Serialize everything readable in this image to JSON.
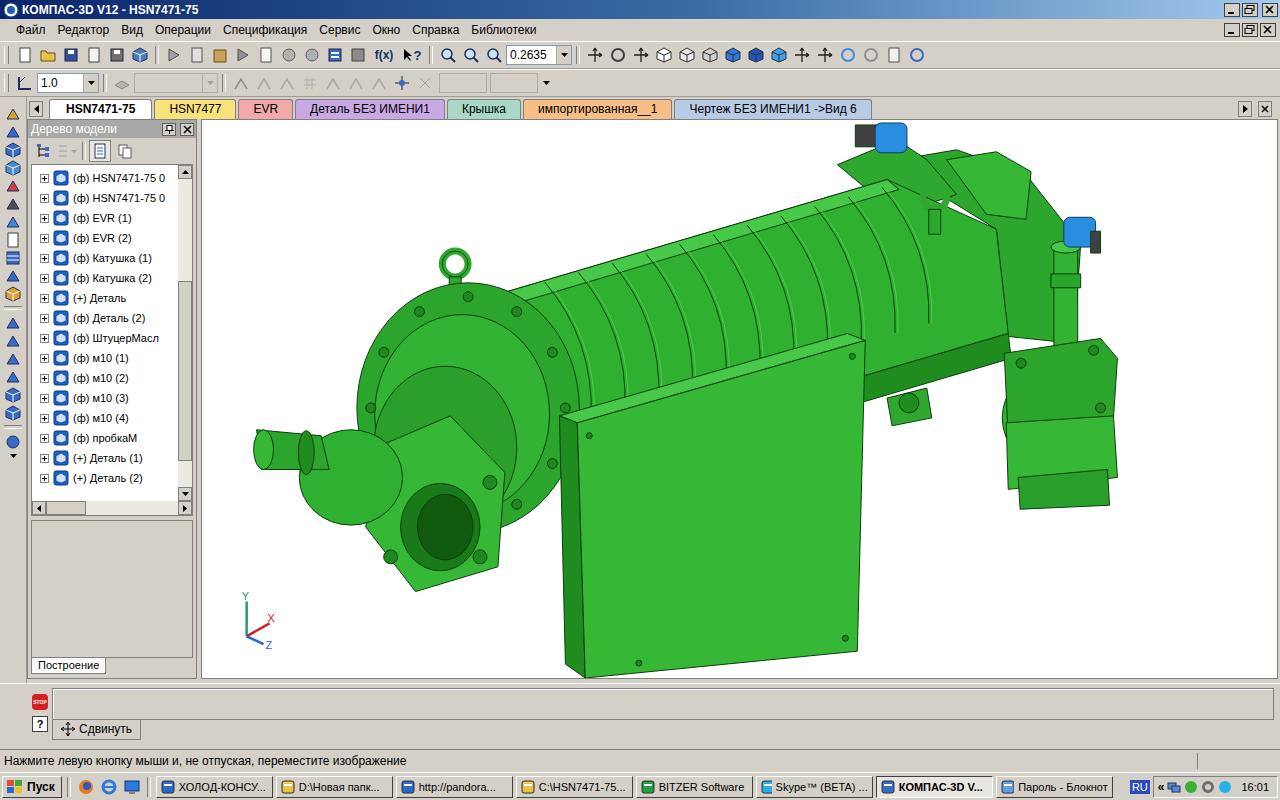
{
  "window": {
    "title": "КОМПАС-3D V12 - HSN7471-75"
  },
  "menu": [
    "Файл",
    "Редактор",
    "Вид",
    "Операции",
    "Спецификация",
    "Сервис",
    "Окно",
    "Справка",
    "Библиотеки"
  ],
  "toolbar": {
    "fx": "f(x)",
    "help": "?",
    "zoom": "0.2635",
    "line_scale": "1.0"
  },
  "tabs": [
    {
      "label": "HSN7471-75",
      "selected": true,
      "color": "#ffffff"
    },
    {
      "label": "HSN7477",
      "selected": false,
      "color": "#f7e27c"
    },
    {
      "label": "EVR",
      "selected": false,
      "color": "#f2a9a9"
    },
    {
      "label": "Деталь БЕЗ ИМЕНИ1",
      "selected": false,
      "color": "#c9a9e3"
    },
    {
      "label": "Крышка",
      "selected": false,
      "color": "#a9d9c6"
    },
    {
      "label": "импортированная__1",
      "selected": false,
      "color": "#f7bf86"
    },
    {
      "label": "Чертеж БЕЗ ИМЕНИ1 ->Вид 6",
      "selected": false,
      "color": "#b8cbe6"
    }
  ],
  "tree": {
    "title": "Дерево модели",
    "tab": "Построение",
    "items": [
      {
        "label": "(ф) HSN7471-75 0",
        "expanded": false
      },
      {
        "label": "(ф) HSN7471-75 0",
        "expanded": false
      },
      {
        "label": "(ф) EVR (1)",
        "expanded": false
      },
      {
        "label": "(ф) EVR (2)",
        "expanded": false
      },
      {
        "label": "(ф) Катушка (1)",
        "expanded": false
      },
      {
        "label": "(ф) Катушка (2)",
        "expanded": false
      },
      {
        "label": "(+) Деталь",
        "expanded": false
      },
      {
        "label": "(ф) Деталь (2)",
        "expanded": false
      },
      {
        "label": "(ф) ШтуцерМасл",
        "expanded": false
      },
      {
        "label": "(ф) м10 (1)",
        "expanded": false
      },
      {
        "label": "(ф) м10 (2)",
        "expanded": false
      },
      {
        "label": "(ф) м10 (3)",
        "expanded": false
      },
      {
        "label": "(ф) м10 (4)",
        "expanded": false
      },
      {
        "label": "(ф) пробкаМ",
        "expanded": false
      },
      {
        "label": "(+) Деталь (1)",
        "expanded": false
      },
      {
        "label": "(+) Деталь (2)",
        "expanded": false
      }
    ]
  },
  "viewport": {
    "axes": [
      {
        "label": "Y",
        "color": "#2a9a6a"
      },
      {
        "label": "X",
        "color": "#d02020"
      },
      {
        "label": "Z",
        "color": "#2466d6"
      }
    ]
  },
  "command": {
    "stop": "STOP",
    "help": "?",
    "tab": "Сдвинуть"
  },
  "status": "Нажмите левую кнопку мыши и, не отпуская, переместите изображение",
  "taskbar": {
    "start": "Пуск",
    "tasks": [
      {
        "label": "ХОЛОД-КОНСУ...",
        "selected": false
      },
      {
        "label": "D:\\Новая папк...",
        "selected": false
      },
      {
        "label": "http://pandora...",
        "selected": false
      },
      {
        "label": "C:\\HSN7471-75...",
        "selected": false
      },
      {
        "label": "BITZER Software",
        "selected": false
      },
      {
        "label": "Skype™ (BETA) ...",
        "selected": false
      },
      {
        "label": "КОМПАС-3D V...",
        "selected": true
      },
      {
        "label": "Пароль - Блокнот",
        "selected": false
      }
    ],
    "lang": "RU",
    "chevron": "«",
    "clock": "16:01"
  }
}
